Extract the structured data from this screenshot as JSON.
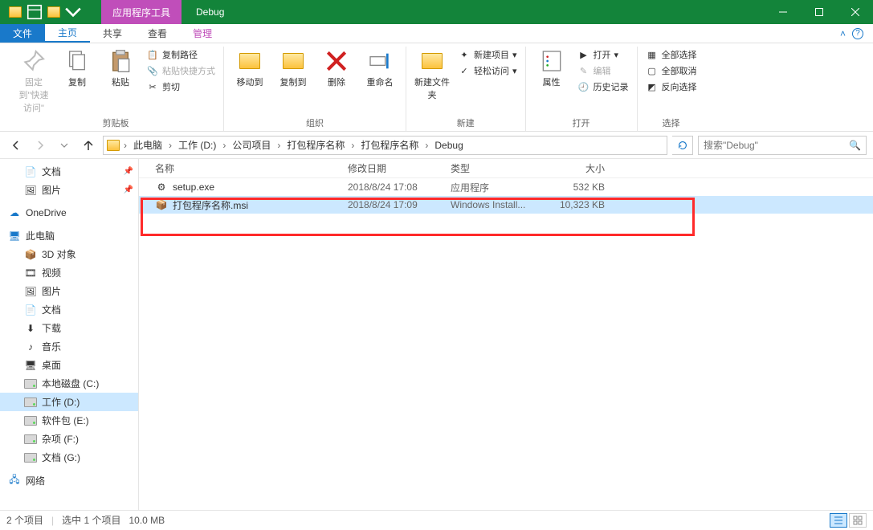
{
  "window": {
    "context_tab": "应用程序工具",
    "title": "Debug"
  },
  "tabs": {
    "file": "文件",
    "home": "主页",
    "share": "共享",
    "view": "查看",
    "manage": "管理"
  },
  "ribbon": {
    "pin_label": "固定到\"快速访问\"",
    "copy": "复制",
    "paste": "粘贴",
    "copy_path": "复制路径",
    "paste_shortcut": "粘贴快捷方式",
    "cut": "剪切",
    "clipboard_group": "剪贴板",
    "move_to": "移动到",
    "copy_to": "复制到",
    "delete": "删除",
    "rename": "重命名",
    "organize_group": "组织",
    "new_folder": "新建文件夹",
    "new_item": "新建项目",
    "easy_access": "轻松访问",
    "new_group": "新建",
    "properties": "属性",
    "open": "打开",
    "edit": "编辑",
    "history": "历史记录",
    "open_group": "打开",
    "select_all": "全部选择",
    "select_none": "全部取消",
    "invert_selection": "反向选择",
    "select_group": "选择"
  },
  "breadcrumb": [
    "此电脑",
    "工作 (D:)",
    "公司项目",
    "打包程序名称",
    "打包程序名称",
    "Debug"
  ],
  "search": {
    "placeholder": "搜索\"Debug\""
  },
  "columns": {
    "name": "名称",
    "date": "修改日期",
    "type": "类型",
    "size": "大小"
  },
  "files": [
    {
      "name": "setup.exe",
      "date": "2018/8/24 17:08",
      "type": "应用程序",
      "size": "532 KB",
      "selected": false,
      "icon": "exe"
    },
    {
      "name": "打包程序名称.msi",
      "date": "2018/8/24 17:09",
      "type": "Windows Install...",
      "size": "10,323 KB",
      "selected": true,
      "icon": "msi"
    }
  ],
  "tree": {
    "quick": [
      {
        "label": "文档",
        "icon": "doc",
        "pinned": true
      },
      {
        "label": "图片",
        "icon": "pic",
        "pinned": true
      }
    ],
    "onedrive": "OneDrive",
    "thispc": "此电脑",
    "pc_children": [
      {
        "label": "3D 对象",
        "icon": "3d"
      },
      {
        "label": "视频",
        "icon": "video"
      },
      {
        "label": "图片",
        "icon": "pic"
      },
      {
        "label": "文档",
        "icon": "doc"
      },
      {
        "label": "下载",
        "icon": "download"
      },
      {
        "label": "音乐",
        "icon": "music"
      },
      {
        "label": "桌面",
        "icon": "desktop"
      },
      {
        "label": "本地磁盘 (C:)",
        "icon": "drive"
      },
      {
        "label": "工作 (D:)",
        "icon": "drive",
        "selected": true
      },
      {
        "label": "软件包 (E:)",
        "icon": "drive"
      },
      {
        "label": "杂项 (F:)",
        "icon": "drive"
      },
      {
        "label": "文档 (G:)",
        "icon": "drive"
      }
    ],
    "network": "网络"
  },
  "status": {
    "item_count": "2 个项目",
    "selection": "选中 1 个项目",
    "size": "10.0 MB"
  }
}
